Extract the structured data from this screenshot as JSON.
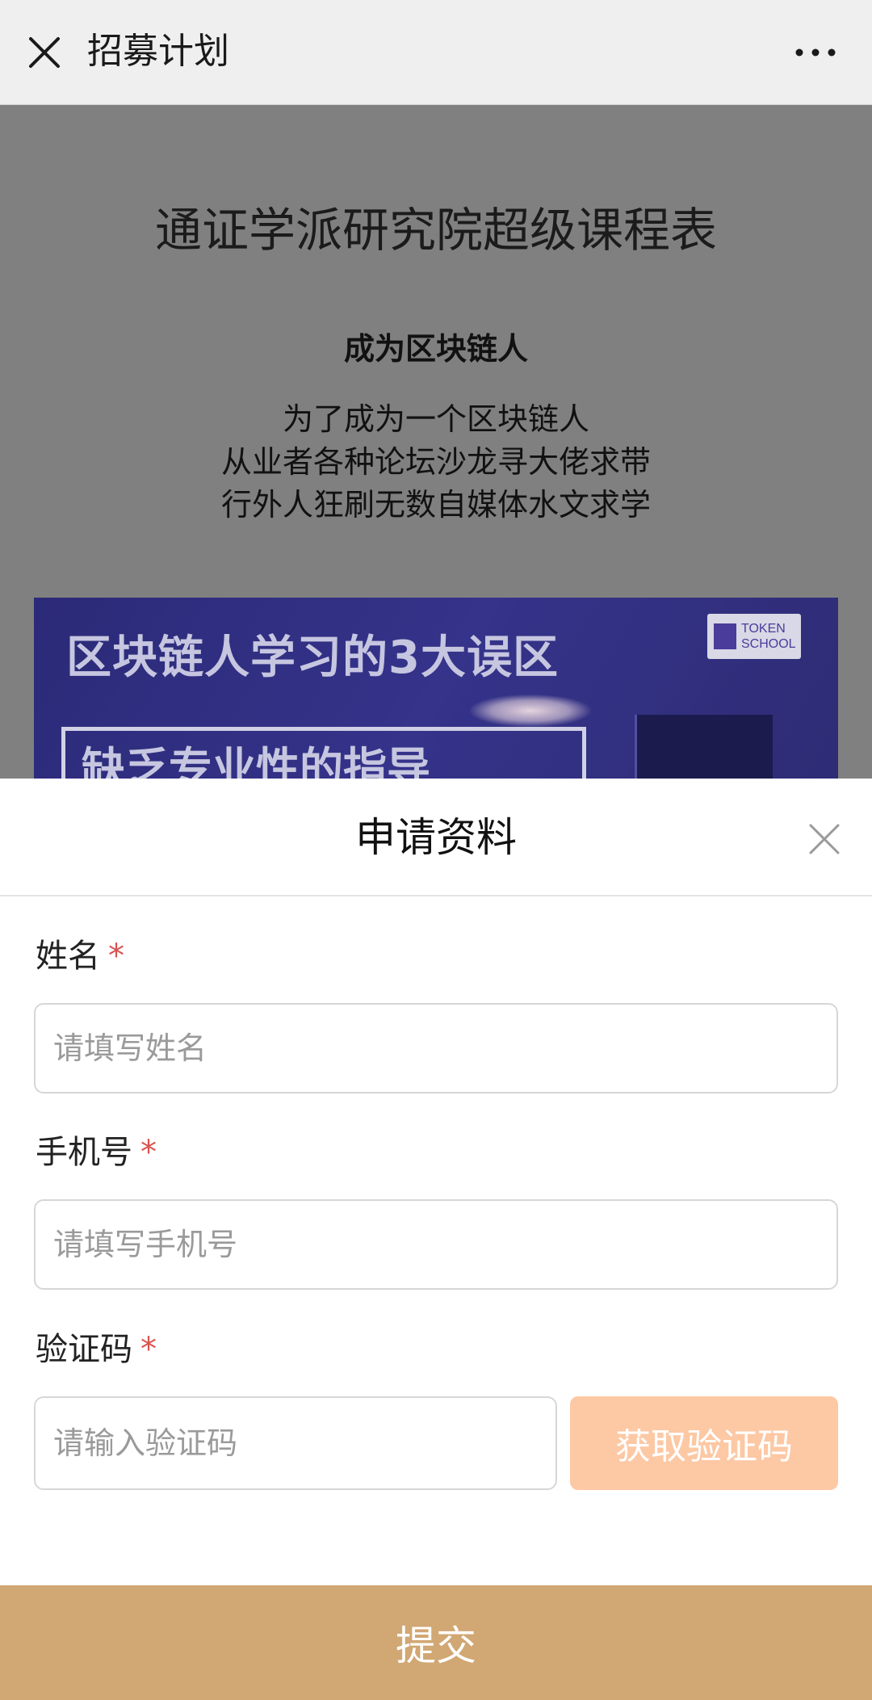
{
  "navbar": {
    "title": "招募计划",
    "close_icon": "close-icon",
    "more_icon": "more-icon"
  },
  "background_page": {
    "course_title": "通证学派研究院超级课程表",
    "subtitle": "成为区块链人",
    "paragraph_lines": [
      "为了成为一个区块链人",
      "从业者各种论坛沙龙寻大佬求带",
      "行外人狂刷无数自媒体水文求学"
    ],
    "banner": {
      "title": "区块链人学习的3大误区",
      "boxed_text": "缺乏专业性的指导",
      "logo_text_line1": "TOKEN",
      "logo_text_line2": "SCHOOL",
      "background_color": "#2f2d7c"
    }
  },
  "form": {
    "title": "申请资料",
    "close_icon": "close-icon",
    "required_mark": "*",
    "fields": [
      {
        "label": "姓名",
        "placeholder": "请填写姓名",
        "value": ""
      },
      {
        "label": "手机号",
        "placeholder": "请填写手机号",
        "value": ""
      },
      {
        "label": "验证码",
        "placeholder": "请输入验证码",
        "value": ""
      }
    ],
    "get_code_label": "获取验证码",
    "submit_label": "提交"
  },
  "colors": {
    "submit_bg": "#d1a773",
    "get_code_bg": "#fdc8a4",
    "required_mark": "#d9534f",
    "overlay": "#808080"
  }
}
